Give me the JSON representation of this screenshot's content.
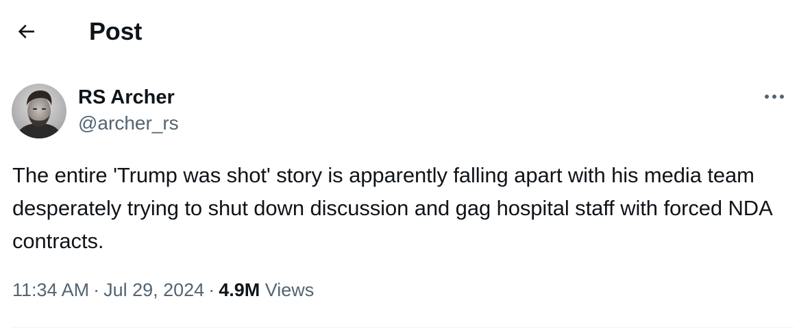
{
  "header": {
    "back_icon": "arrow-left-icon",
    "title": "Post"
  },
  "post": {
    "author": {
      "display_name": "RS Archer",
      "handle": "@archer_rs",
      "avatar_icon": "avatar-photo"
    },
    "more_icon": "ellipsis-icon",
    "text": "The entire 'Trump was shot' story is apparently falling apart with his media team desperately trying to shut down discussion and gag hospital staff with forced NDA contracts.",
    "meta": {
      "time": "11:34 AM",
      "separator": "·",
      "date": "Jul 29, 2024",
      "views_count": "4.9M",
      "views_label": "Views"
    }
  },
  "colors": {
    "text_primary": "#0f1419",
    "text_secondary": "#536471",
    "divider": "#eff3f4"
  }
}
